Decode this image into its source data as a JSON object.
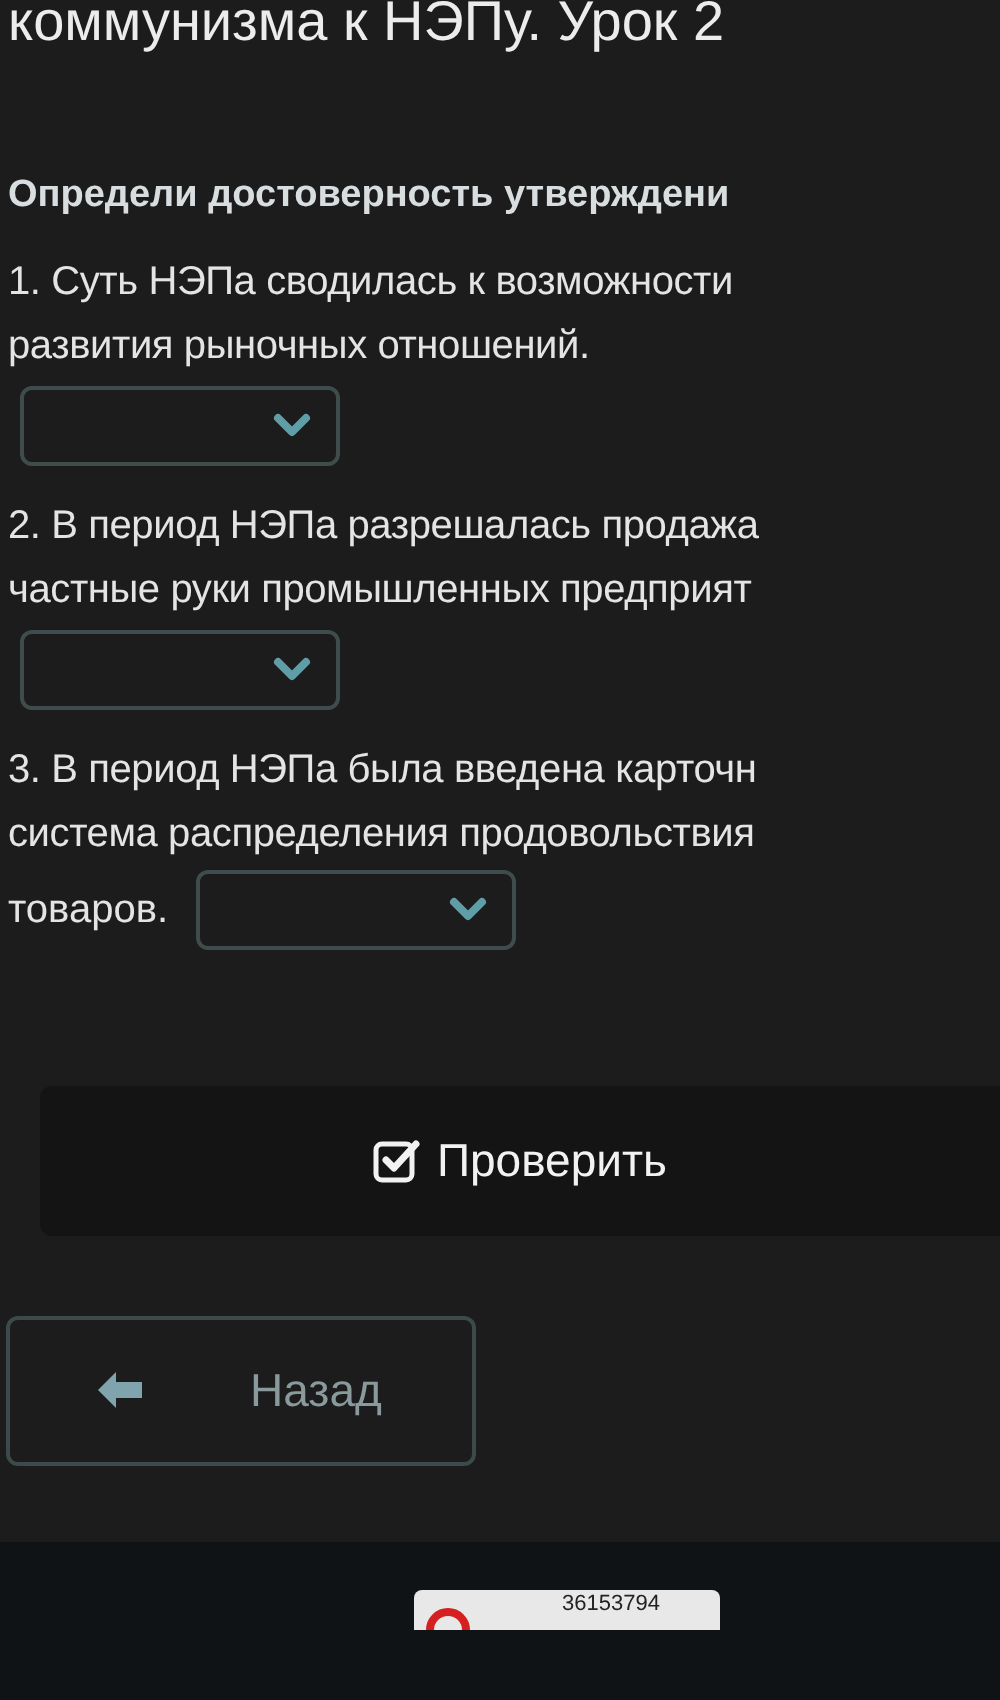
{
  "lesson_title": "коммунизма к НЭПу. Урок 2",
  "task_heading": "Определи достоверность утверждени",
  "questions": [
    {
      "kind": "select_below",
      "lines": [
        "1. Суть НЭПа сводилась к возможности",
        "развития рыночных отношений."
      ]
    },
    {
      "kind": "select_below",
      "lines": [
        "2. В период НЭПа разрешалась продажа",
        "частные руки промышленных предприят"
      ]
    },
    {
      "kind": "select_inline",
      "lines": [
        "3. В период НЭПа была введена карточн",
        "система распределения продовольствия",
        "товаров."
      ]
    }
  ],
  "check_button": {
    "label": "Проверить"
  },
  "back_button": {
    "label": "Назад"
  },
  "footer": {
    "counter": "36153794"
  }
}
